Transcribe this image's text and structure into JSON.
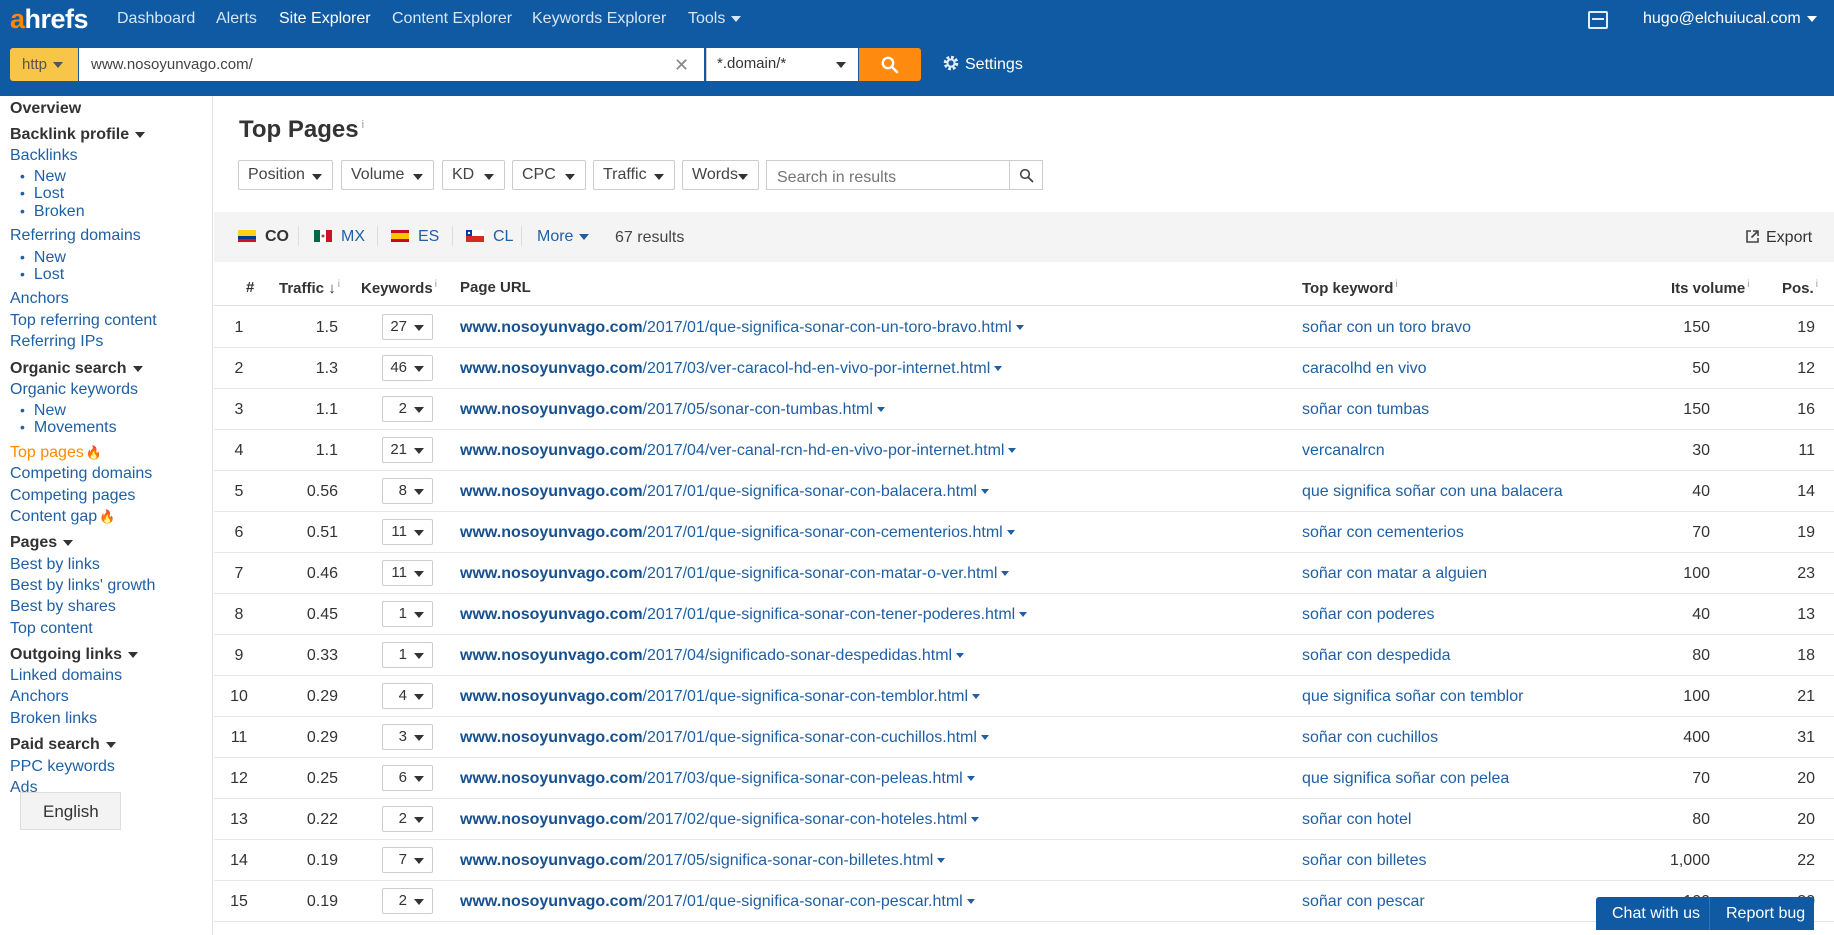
{
  "brand": {
    "logo_prefix": "a",
    "logo_rest": "hrefs"
  },
  "nav": {
    "items": [
      "Dashboard",
      "Alerts",
      "Site Explorer",
      "Content Explorer",
      "Keywords Explorer",
      "Tools"
    ],
    "active": "Site Explorer",
    "user_email": "hugo@elchuiucal.com"
  },
  "search": {
    "protocol": "http",
    "url": "www.nosoyunvago.com/",
    "mode": "*.domain/*",
    "settings_label": "Settings"
  },
  "sidebar": {
    "overview": "Overview",
    "backlink_profile": "Backlink profile",
    "backlinks": "Backlinks",
    "backlinks_new": "New",
    "backlinks_lost": "Lost",
    "backlinks_broken": "Broken",
    "referring_domains": "Referring domains",
    "rd_new": "New",
    "rd_lost": "Lost",
    "anchors": "Anchors",
    "top_referring_content": "Top referring content",
    "referring_ips": "Referring IPs",
    "organic_search": "Organic search",
    "organic_keywords": "Organic keywords",
    "ok_new": "New",
    "ok_movements": "Movements",
    "top_pages": "Top pages",
    "competing_domains": "Competing domains",
    "competing_pages": "Competing pages",
    "content_gap": "Content gap",
    "pages": "Pages",
    "best_by_links": "Best by links",
    "best_by_links_growth": "Best by links' growth",
    "best_by_shares": "Best by shares",
    "top_content": "Top content",
    "outgoing_links": "Outgoing links",
    "linked_domains": "Linked domains",
    "anchors2": "Anchors",
    "broken_links": "Broken links",
    "paid_search": "Paid search",
    "ppc_keywords": "PPC keywords",
    "ads": "Ads",
    "language": "English"
  },
  "main": {
    "title": "Top Pages",
    "info_mark": "i",
    "filters": [
      "Position",
      "Volume",
      "KD",
      "CPC",
      "Traffic",
      "Words"
    ],
    "search_placeholder": "Search in results",
    "countries": [
      "CO",
      "MX",
      "ES",
      "CL"
    ],
    "more_label": "More",
    "results_count": "67 results",
    "export_label": "Export"
  },
  "table": {
    "headers": {
      "num": "#",
      "traffic": "Traffic",
      "keywords": "Keywords",
      "page_url": "Page URL",
      "top_keyword": "Top keyword",
      "volume": "Its volume",
      "position": "Pos."
    },
    "domain": "www.nosoyunvago.com",
    "rows": [
      {
        "n": "1",
        "traffic": "1.5",
        "kw": "27",
        "path": "/2017/01/que-significa-sonar-con-un-toro-bravo.html",
        "top": "soñar con un toro bravo",
        "vol": "150",
        "pos": "19"
      },
      {
        "n": "2",
        "traffic": "1.3",
        "kw": "46",
        "path": "/2017/03/ver-caracol-hd-en-vivo-por-internet.html",
        "top": "caracolhd en vivo",
        "vol": "50",
        "pos": "12"
      },
      {
        "n": "3",
        "traffic": "1.1",
        "kw": "2",
        "path": "/2017/05/sonar-con-tumbas.html",
        "top": "soñar con tumbas",
        "vol": "150",
        "pos": "16"
      },
      {
        "n": "4",
        "traffic": "1.1",
        "kw": "21",
        "path": "/2017/04/ver-canal-rcn-hd-en-vivo-por-internet.html",
        "top": "vercanalrcn",
        "vol": "30",
        "pos": "11"
      },
      {
        "n": "5",
        "traffic": "0.56",
        "kw": "8",
        "path": "/2017/01/que-significa-sonar-con-balacera.html",
        "top": "que significa soñar con una balacera",
        "vol": "40",
        "pos": "14"
      },
      {
        "n": "6",
        "traffic": "0.51",
        "kw": "11",
        "path": "/2017/01/que-significa-sonar-con-cementerios.html",
        "top": "soñar con cementerios",
        "vol": "70",
        "pos": "19"
      },
      {
        "n": "7",
        "traffic": "0.46",
        "kw": "11",
        "path": "/2017/01/que-significa-sonar-con-matar-o-ver.html",
        "top": "soñar con matar a alguien",
        "vol": "100",
        "pos": "23"
      },
      {
        "n": "8",
        "traffic": "0.45",
        "kw": "1",
        "path": "/2017/01/que-significa-sonar-con-tener-poderes.html",
        "top": "soñar con poderes",
        "vol": "40",
        "pos": "13"
      },
      {
        "n": "9",
        "traffic": "0.33",
        "kw": "1",
        "path": "/2017/04/significado-sonar-despedidas.html",
        "top": "soñar con despedida",
        "vol": "80",
        "pos": "18"
      },
      {
        "n": "10",
        "traffic": "0.29",
        "kw": "4",
        "path": "/2017/01/que-significa-sonar-con-temblor.html",
        "top": "que significa soñar con temblor",
        "vol": "100",
        "pos": "21"
      },
      {
        "n": "11",
        "traffic": "0.29",
        "kw": "3",
        "path": "/2017/01/que-significa-sonar-con-cuchillos.html",
        "top": "soñar con cuchillos",
        "vol": "400",
        "pos": "31"
      },
      {
        "n": "12",
        "traffic": "0.25",
        "kw": "6",
        "path": "/2017/03/que-significa-sonar-con-peleas.html",
        "top": "que significa soñar con pelea",
        "vol": "70",
        "pos": "20"
      },
      {
        "n": "13",
        "traffic": "0.22",
        "kw": "2",
        "path": "/2017/02/que-significa-sonar-con-hoteles.html",
        "top": "soñar con hotel",
        "vol": "80",
        "pos": "20"
      },
      {
        "n": "14",
        "traffic": "0.19",
        "kw": "7",
        "path": "/2017/05/significa-sonar-con-billetes.html",
        "top": "soñar con billetes",
        "vol": "1,000",
        "pos": "22"
      },
      {
        "n": "15",
        "traffic": "0.19",
        "kw": "2",
        "path": "/2017/01/que-significa-sonar-con-pescar.html",
        "top": "soñar con pescar",
        "vol": "100",
        "pos": "20"
      }
    ]
  },
  "footer": {
    "chat_label": "Chat with us",
    "report_label": "Report bug"
  }
}
